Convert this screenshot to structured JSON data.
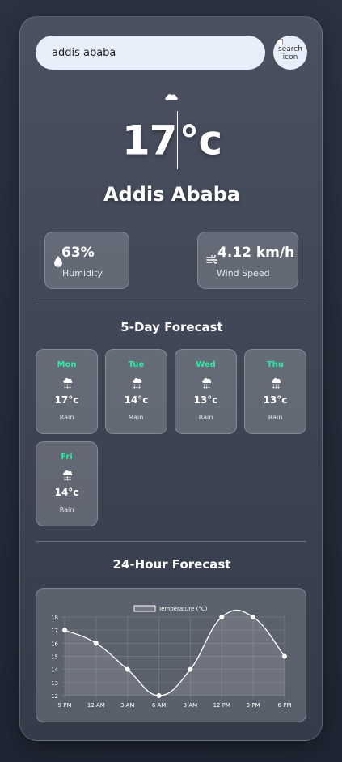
{
  "search": {
    "value": "addis ababa",
    "button_alt": "search icon"
  },
  "current": {
    "icon": "cloud-icon",
    "temperature": "17",
    "unit": "°c",
    "city": "Addis Ababa",
    "humidity": {
      "value": "63%",
      "label": "Humidity",
      "icon": "water-drop-icon"
    },
    "wind": {
      "value": "4.12 km/h",
      "label": "Wind Speed",
      "icon": "wind-icon"
    }
  },
  "forecast5": {
    "title": "5-Day Forecast",
    "days": [
      {
        "day": "Mon",
        "temp": "17°c",
        "desc": "Rain",
        "icon": "rain-cloud-icon"
      },
      {
        "day": "Tue",
        "temp": "14°c",
        "desc": "Rain",
        "icon": "rain-cloud-icon"
      },
      {
        "day": "Wed",
        "temp": "13°c",
        "desc": "Rain",
        "icon": "rain-cloud-icon"
      },
      {
        "day": "Thu",
        "temp": "13°c",
        "desc": "Rain",
        "icon": "rain-cloud-icon"
      },
      {
        "day": "Fri",
        "temp": "14°c",
        "desc": "Rain",
        "icon": "rain-cloud-icon"
      }
    ]
  },
  "forecast24": {
    "title": "24-Hour Forecast"
  },
  "colors": {
    "accent_day": "#2fe6a4",
    "input_bg": "#e8eefa",
    "line": "#ffffff"
  },
  "chart_data": {
    "type": "line",
    "categories": [
      "9 PM",
      "12 AM",
      "3 AM",
      "6 AM",
      "9 AM",
      "12 PM",
      "3 PM",
      "6 PM"
    ],
    "series": [
      {
        "name": "Temperature (°C)",
        "values": [
          17,
          16,
          14,
          12,
          14,
          18,
          18,
          15
        ]
      }
    ],
    "ylim": [
      12,
      18
    ],
    "yticks": [
      12,
      13,
      14,
      15,
      16,
      17,
      18
    ],
    "legend": "top-center",
    "grid": true,
    "fill": true
  }
}
